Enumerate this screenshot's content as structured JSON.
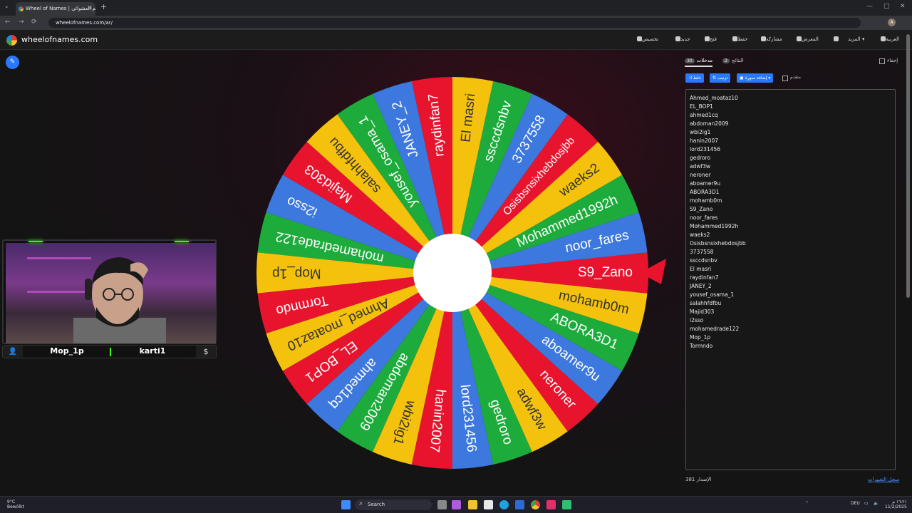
{
  "browser": {
    "tab_title": "Wheel of Names | اسم العشوائي",
    "tab_close": "✕",
    "new_tab": "+",
    "tab_menu": "⌄",
    "url": "wheelofnames.com/ar/",
    "avatar_letter": "A",
    "back": "←",
    "forward": "→",
    "reload": "⟳",
    "minimize": "—",
    "maximize": "□",
    "close": "✕"
  },
  "site": {
    "logo": "wheelofnames.com",
    "menu": {
      "customize": "تخصيص",
      "new": "جديد",
      "open": "فتح",
      "save": "حفظ",
      "share": "مشاركة",
      "gallery": "المعرض",
      "more": "المزيد",
      "language": "العربية"
    }
  },
  "panel": {
    "tab_entries": "مدخلات",
    "entries_count": "30",
    "tab_results": "النتائج",
    "results_count": "2",
    "hide_label": "إخفاء",
    "shuffle": "خلط",
    "sort": "ترتيب",
    "add_image": "إضافة صورة",
    "advanced": "متقدم",
    "version": "الإصدار 381",
    "changelog": "سجل التغييرات"
  },
  "wheel": {
    "entries": [
      "Ahmed_moataz10",
      "EL_BOP1",
      "ahmed1cq",
      "abdoman2009",
      "wbi2ig1",
      "hanin2007",
      "lord231456",
      "gedroro",
      "adwf3w",
      "neroner",
      "aboamer9u",
      "ABORA3D1",
      "mohamb0m",
      "S9_Zano",
      "noor_fares",
      "Mohammed1992h",
      "waeks2",
      "Osisbsnsixhebdosjbb",
      "3737558",
      "ssccdsnbv",
      "El masri",
      "raydinfan7",
      "JANEY_2",
      "yousef_osama_1",
      "salahhfdfbu",
      "Majid303",
      "i2sso",
      "mohamedrade122",
      "Mop_1p",
      "Tormndo"
    ],
    "colors": [
      "#e8142e",
      "#f4c20d",
      "#1dab3b",
      "#3d78de"
    ],
    "text_color_on_yellow": "#333333"
  },
  "webcam": {
    "left_name": "Mop_1p",
    "right_name": "karti1",
    "user_icon": "👤",
    "dollar_icon": "$"
  },
  "taskbar": {
    "temp": "9°C",
    "weather": "Bewölkt",
    "search": "Search",
    "lang": "DEU",
    "time": "١٦:٢١ م",
    "date": "11/2/2025"
  }
}
